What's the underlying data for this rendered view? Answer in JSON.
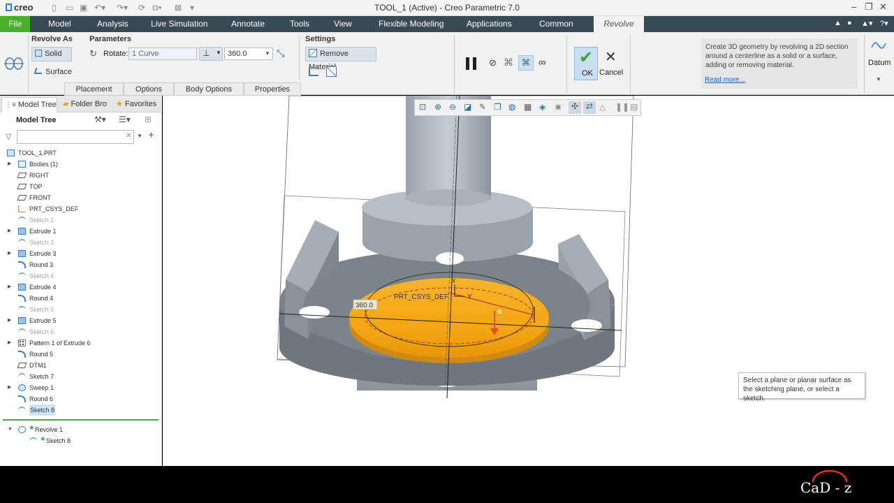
{
  "window": {
    "app_logo": "creo",
    "title": "TOOL_1 (Active) - Creo Parametric 7.0"
  },
  "ribbon_tabs": {
    "file": "File",
    "model": "Model",
    "analysis": "Analysis",
    "live_simulation": "Live Simulation",
    "annotate": "Annotate",
    "tools": "Tools",
    "view": "View",
    "flexible_modeling": "Flexible Modeling",
    "applications": "Applications",
    "common": "Common",
    "revolve": "Revolve"
  },
  "ribbon": {
    "revolve_as_title": "Revolve As",
    "solid_label": "Solid",
    "surface_label": "Surface",
    "parameters_title": "Parameters",
    "rotate_label": "Rotate:",
    "rotate_value": "1 Curve",
    "angle_value": "360.0",
    "settings_title": "Settings",
    "remove_material_label": "Remove Material",
    "ok_label": "OK",
    "cancel_label": "Cancel",
    "datum_label": "Datum",
    "sub_tabs": [
      "Placement",
      "Options",
      "Body Options",
      "Properties"
    ],
    "help_text": "Create 3D geometry by revolving a 2D section around a centerline as a solid or a surface, adding or removing material.",
    "help_link": "Read more..."
  },
  "panel_tabs": {
    "model_tree": "Model Tree",
    "folder_browser": "Folder Bro",
    "favorites": "Favorites"
  },
  "model_tree": {
    "header": "Model Tree",
    "filter_placeholder": "",
    "items": [
      {
        "label": "TOOL_1.PRT",
        "icon": "part-icon"
      },
      {
        "label": "Bodies (1)",
        "icon": "bodies-icon"
      },
      {
        "label": "RIGHT",
        "icon": "datum-plane-icon"
      },
      {
        "label": "TOP",
        "icon": "datum-plane-icon"
      },
      {
        "label": "FRONT",
        "icon": "datum-plane-icon"
      },
      {
        "label": "PRT_CSYS_DEF",
        "icon": "csys-icon"
      },
      {
        "label": "Sketch 1",
        "icon": "sketch-icon"
      },
      {
        "label": "Extrude 1",
        "icon": "extrude-icon"
      },
      {
        "label": "Sketch 3",
        "icon": "sketch-icon"
      },
      {
        "label": "Extrude 3",
        "icon": "extrude-icon"
      },
      {
        "label": "Round 3",
        "icon": "round-icon"
      },
      {
        "label": "Sketch 4",
        "icon": "sketch-icon"
      },
      {
        "label": "Extrude 4",
        "icon": "extrude-icon"
      },
      {
        "label": "Round 4",
        "icon": "round-icon"
      },
      {
        "label": "Sketch 5",
        "icon": "sketch-icon"
      },
      {
        "label": "Extrude 5",
        "icon": "extrude-icon"
      },
      {
        "label": "Sketch 6",
        "icon": "sketch-icon"
      },
      {
        "label": "Pattern 1 of Extrude 6",
        "icon": "pattern-icon"
      },
      {
        "label": "Round 5",
        "icon": "round-icon"
      },
      {
        "label": "DTM1",
        "icon": "datum-plane-icon"
      },
      {
        "label": "Sketch 7",
        "icon": "sketch-icon"
      },
      {
        "label": "Sweep 1",
        "icon": "sweep-icon"
      },
      {
        "label": "Round 6",
        "icon": "round-icon"
      },
      {
        "label": "Sketch 8",
        "icon": "sketch-icon"
      }
    ],
    "feature_items": [
      {
        "label": "Revolve 1",
        "icon": "revolve-icon"
      },
      {
        "label": "Sketch 8",
        "icon": "sketch-icon"
      }
    ]
  },
  "viewport": {
    "csys_label": "PRT_CSYS_DEF",
    "axis_y": "Y",
    "axis_x": "X",
    "angle_dim": "360.0"
  },
  "tooltip": "Select a plane or planar surface as the sketching plane, or select a sketch.",
  "watermark": "CaD - z"
}
